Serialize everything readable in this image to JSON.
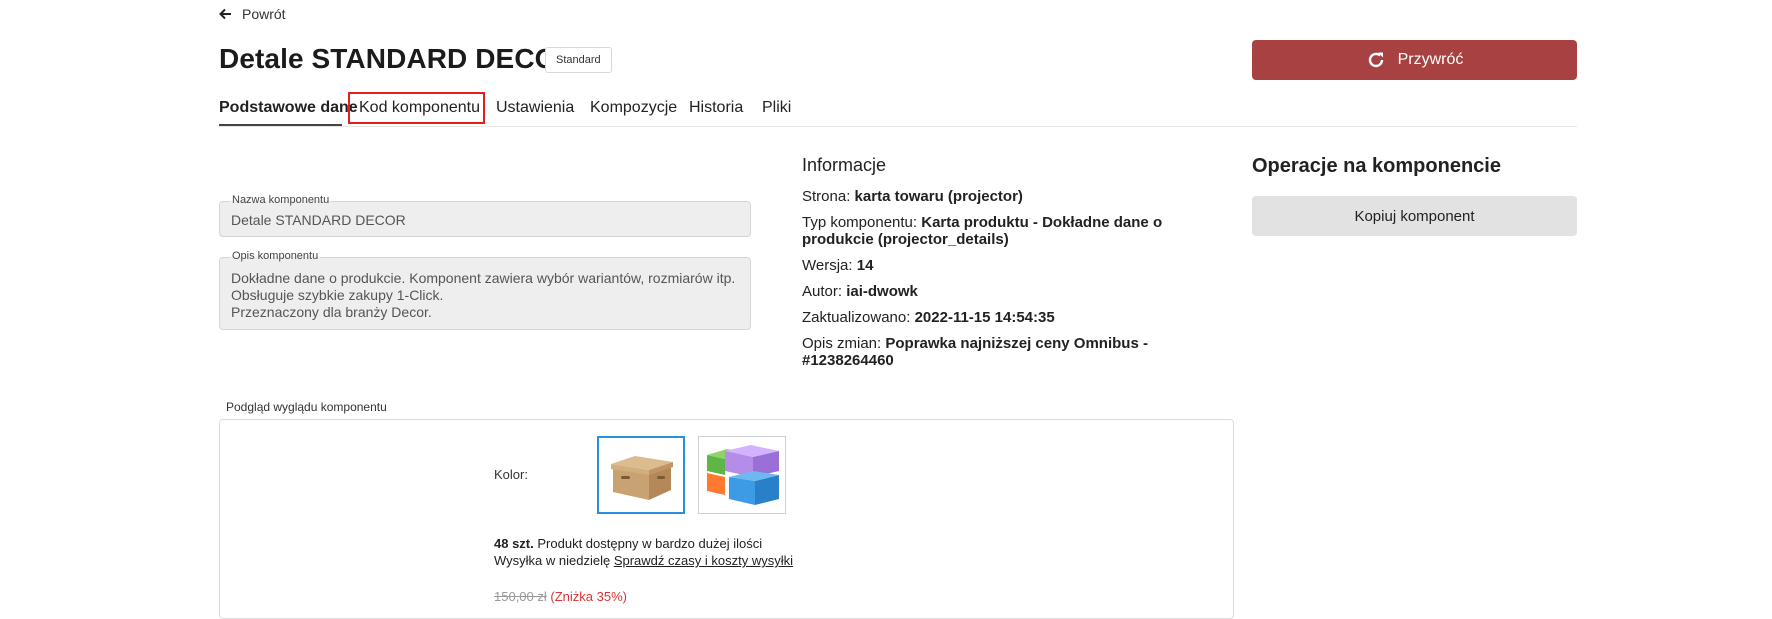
{
  "header": {
    "back_label": "Powrót",
    "title": "Detale STANDARD DECOR",
    "badge": "Standard",
    "restore_label": "Przywróć"
  },
  "tabs": [
    {
      "label": "Podstawowe dane",
      "active": true
    },
    {
      "label": "Kod komponentu",
      "highlighted": true
    },
    {
      "label": "Ustawienia"
    },
    {
      "label": "Kompozycje"
    },
    {
      "label": "Historia"
    },
    {
      "label": "Pliki"
    }
  ],
  "form": {
    "name_label": "Nazwa komponentu",
    "name_value": "Detale STANDARD DECOR",
    "desc_label": "Opis komponentu",
    "desc_lines": [
      "Dokładne dane o produkcie. Komponent zawiera wybór wariantów, rozmiarów itp.",
      "Obsługuje szybkie zakupy 1-Click.",
      "Przeznaczony dla branży Decor."
    ]
  },
  "info": {
    "heading": "Informacje",
    "rows": [
      {
        "key": "Strona:",
        "value": "karta towaru (projector)"
      },
      {
        "key": "Typ komponentu:",
        "value": "Karta produktu - Dokładne dane o produkcie (projector_details)"
      },
      {
        "key": "Wersja:",
        "value": "14"
      },
      {
        "key": "Autor:",
        "value": "iai-dwowk"
      },
      {
        "key": "Zaktualizowano:",
        "value": "2022-11-15 14:54:35"
      },
      {
        "key": "Opis zmian:",
        "value": "Poprawka najniższej ceny Omnibus - #1238264460"
      }
    ]
  },
  "operations": {
    "heading": "Operacje na komponencie",
    "copy_label": "Kopiuj komponent"
  },
  "preview": {
    "label": "Podgląd wyglądu komponentu",
    "color_label": "Kolor:",
    "stock_qty": "48 szt.",
    "stock_text": "Produkt dostępny w bardzo dużej ilości",
    "shipping_text": "Wysyłka w niedzielę",
    "shipping_link": "Sprawdź czasy i koszty wysyłki",
    "old_price": "150,00 zł",
    "discount": "(Zniżka 35%)"
  },
  "colors": {
    "restore_bg": "#a84242",
    "highlight": "#e02020",
    "selected_thumb": "#2b8fe0"
  }
}
